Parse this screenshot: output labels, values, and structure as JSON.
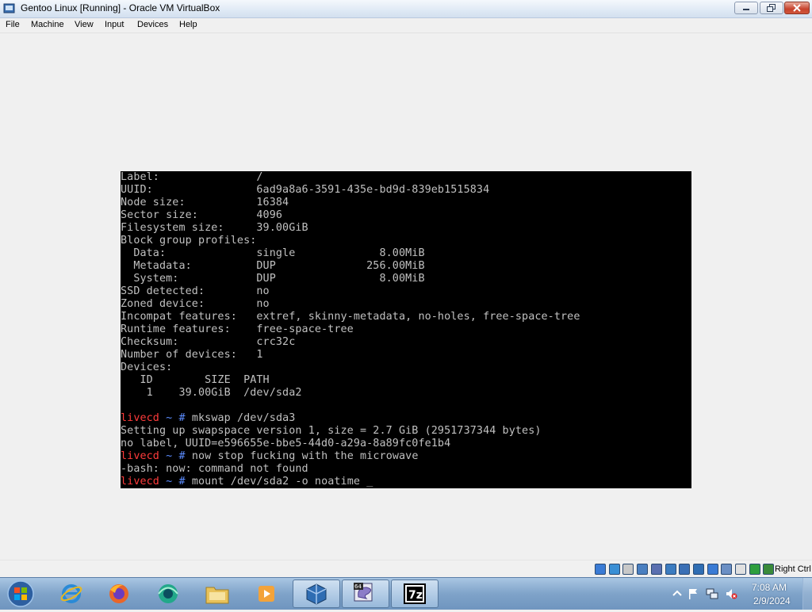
{
  "window": {
    "title": "Gentoo Linux [Running] - Oracle VM VirtualBox"
  },
  "menu": {
    "items": [
      "File",
      "Machine",
      "View",
      "Input",
      "Devices",
      "Help"
    ]
  },
  "terminal": {
    "lines": [
      {
        "text": "Label:               /"
      },
      {
        "text": "UUID:                6ad9a8a6-3591-435e-bd9d-839eb1515834"
      },
      {
        "text": "Node size:           16384"
      },
      {
        "text": "Sector size:         4096"
      },
      {
        "text": "Filesystem size:     39.00GiB"
      },
      {
        "text": "Block group profiles:"
      },
      {
        "text": "  Data:              single             8.00MiB"
      },
      {
        "text": "  Metadata:          DUP              256.00MiB"
      },
      {
        "text": "  System:            DUP                8.00MiB"
      },
      {
        "text": "SSD detected:        no"
      },
      {
        "text": "Zoned device:        no"
      },
      {
        "text": "Incompat features:   extref, skinny-metadata, no-holes, free-space-tree"
      },
      {
        "text": "Runtime features:    free-space-tree"
      },
      {
        "text": "Checksum:            crc32c"
      },
      {
        "text": "Number of devices:   1"
      },
      {
        "text": "Devices:"
      },
      {
        "text": "   ID        SIZE  PATH"
      },
      {
        "text": "    1    39.00GiB  /dev/sda2"
      },
      {
        "text": ""
      },
      {
        "user": "livecd",
        "dir": "~",
        "sym": "#",
        "cmd": " mkswap /dev/sda3"
      },
      {
        "text": "Setting up swapspace version 1, size = 2.7 GiB (2951737344 bytes)"
      },
      {
        "text": "no label, UUID=e596655e-bbe5-44d0-a29a-8a89fc0fe1b4"
      },
      {
        "user": "livecd",
        "dir": "~",
        "sym": "#",
        "cmd": " now stop fucking with the microwave"
      },
      {
        "text": "-bash: now: command not found"
      },
      {
        "user": "livecd",
        "dir": "~",
        "sym": "#",
        "cmd": " mount /dev/sda2 -o noatime _"
      }
    ]
  },
  "statusbar": {
    "host_key": "Right Ctrl",
    "icons": [
      "hard-disk-icon",
      "optical-drive-icon",
      "floppy-icon",
      "network-icon",
      "usb-icon",
      "shared-folders-icon",
      "display-icon",
      "video-capture-icon",
      "keyboard-capture-icon",
      "mouse-integration-icon",
      "cpu-icon",
      "vt-x-icon",
      "guest-additions-icon"
    ]
  },
  "taskbar": {
    "apps": [
      {
        "name": "internet-explorer",
        "active": false
      },
      {
        "name": "firefox",
        "active": false
      },
      {
        "name": "media-app",
        "active": false
      },
      {
        "name": "file-explorer",
        "active": false
      },
      {
        "name": "media-player",
        "active": false
      },
      {
        "name": "virtualbox",
        "active": true
      },
      {
        "name": "virtualbox-vm",
        "active": true
      },
      {
        "name": "7-zip",
        "active": true
      }
    ],
    "vm_badge": "64",
    "sevenzip_label": "7z"
  },
  "clock": {
    "time": "7:08 AM",
    "date": "2/9/2024"
  },
  "colors": {
    "prompt_user": "#ff3b3b",
    "prompt_dir": "#5b8cff",
    "terminal_text": "#c0c0c0",
    "terminal_bg": "#000000"
  }
}
